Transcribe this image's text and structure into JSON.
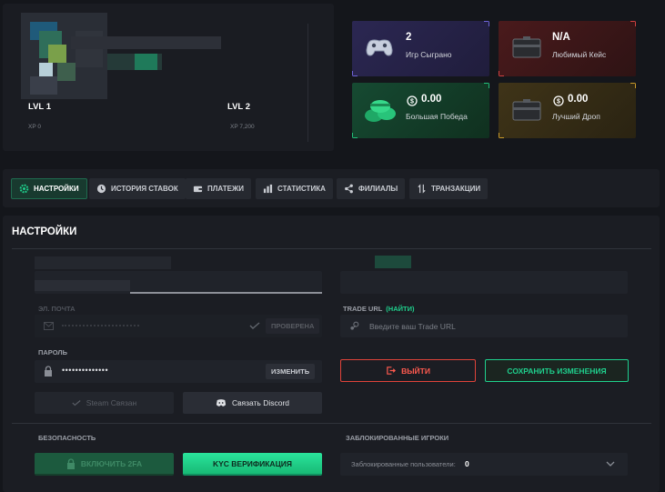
{
  "profile": {
    "level_current": "LVL 1",
    "level_next": "LVL 2",
    "xp_current": "XP 0",
    "xp_next": "XP 7,200"
  },
  "stats": [
    {
      "value": "2",
      "label": "Игр Сыграно",
      "icon": "gamepad-icon",
      "color": "#27244a"
    },
    {
      "value": "N/A",
      "label": "Любимый Кейс",
      "icon": "case-icon",
      "color": "#3b1618"
    },
    {
      "value": "0.00",
      "label": "Большая Победа",
      "icon": "money-stack-icon",
      "color": "#133a28"
    },
    {
      "value": "0.00",
      "label": "Лучший Дроп",
      "icon": "case-icon",
      "color": "#2f2714"
    }
  ],
  "tabs": [
    {
      "label": "НАСТРОЙКИ",
      "icon": "gear-icon",
      "active": true
    },
    {
      "label": "ИСТОРИЯ СТАВОК",
      "icon": "clock-icon"
    },
    {
      "label": "ПЛАТЕЖИ",
      "icon": "wallet-icon"
    },
    {
      "label": "СТАТИСТИКА",
      "icon": "bar-chart-icon"
    },
    {
      "label": "ФИЛИАЛЫ",
      "icon": "share-icon"
    },
    {
      "label": "ТРАНЗАКЦИИ",
      "icon": "transfer-icon"
    }
  ],
  "settings": {
    "title": "НАСТРОЙКИ",
    "email_label": "ЭЛ. ПОЧТА",
    "email_verified": "ПРОВЕРЕНА",
    "trade_url_label": "TRADE URL",
    "trade_url_link": "(НАЙТИ)",
    "trade_url_placeholder": "Введите ваш Trade URL",
    "password_label": "ПАРОЛЬ",
    "password_value": "••••••••••••••",
    "password_change": "ИЗМЕНИТЬ",
    "logout": "ВЫЙТИ",
    "save": "СОХРАНИТЬ ИЗМЕНЕНИЯ",
    "steam_linked": "Steam Связан",
    "discord_link": "Связать Discord",
    "security_label": "БЕЗОПАСНОСТЬ",
    "enable_2fa": "ВКЛЮЧИТЬ 2FA",
    "kyc": "KYC ВЕРИФИКАЦИЯ",
    "blocked_label": "ЗАБЛОКИРОВАННЫЕ ИГРОКИ",
    "blocked_users_text": "Заблокированные пользователи:",
    "blocked_count": "0"
  },
  "colors": {
    "accent": "#1fd08d",
    "danger": "#e0433a",
    "background": "#14161b",
    "panel": "#1b1d23"
  }
}
